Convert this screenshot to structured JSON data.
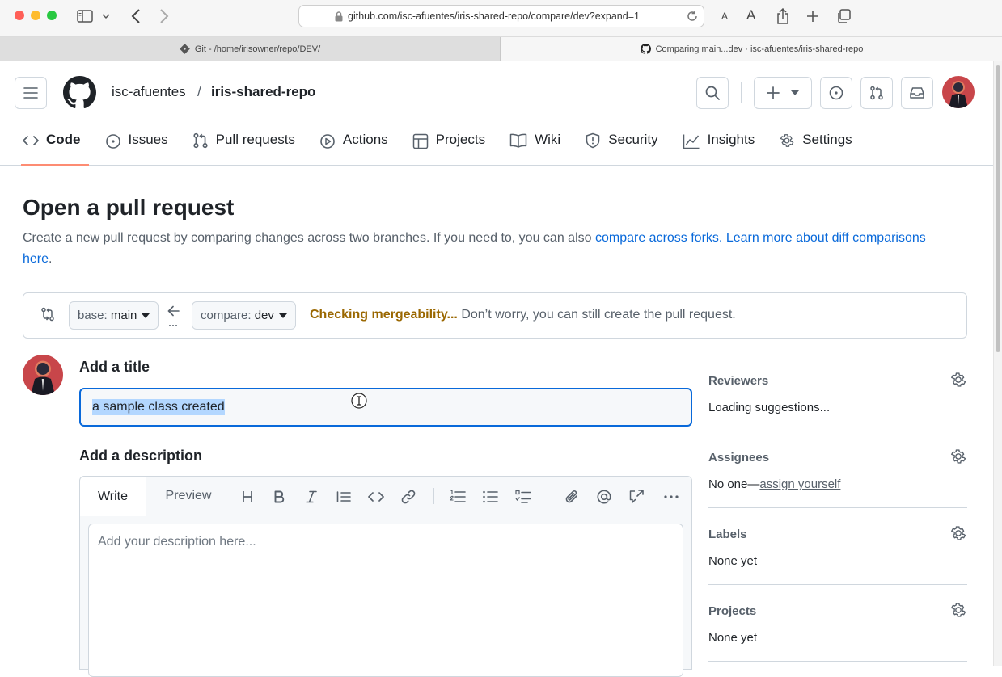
{
  "browser": {
    "url": "github.com/isc-afuentes/iris-shared-repo/compare/dev?expand=1",
    "reader_small": "A",
    "reader_large": "A",
    "tabs": [
      {
        "label": "Git - /home/irisowner/repo/DEV/",
        "active": false
      },
      {
        "label": "Comparing main...dev · isc-afuentes/iris-shared-repo",
        "active": true
      }
    ]
  },
  "header": {
    "owner": "isc-afuentes",
    "separator": "/",
    "repo": "iris-shared-repo"
  },
  "nav": [
    {
      "label": "Code",
      "icon": "code-icon",
      "active": true
    },
    {
      "label": "Issues",
      "icon": "issue-icon",
      "active": false
    },
    {
      "label": "Pull requests",
      "icon": "pull-request-icon",
      "active": false
    },
    {
      "label": "Actions",
      "icon": "play-icon",
      "active": false
    },
    {
      "label": "Projects",
      "icon": "table-icon",
      "active": false
    },
    {
      "label": "Wiki",
      "icon": "book-icon",
      "active": false
    },
    {
      "label": "Security",
      "icon": "shield-icon",
      "active": false
    },
    {
      "label": "Insights",
      "icon": "graph-icon",
      "active": false
    },
    {
      "label": "Settings",
      "icon": "gear-icon",
      "active": false
    }
  ],
  "main": {
    "title": "Open a pull request",
    "description_prefix": "Create a new pull request by comparing changes across two branches. If you need to, you can also ",
    "link_forks": "compare across forks.",
    "link_learn": "Learn more about diff comparisons here",
    "description_suffix": ".",
    "compare": {
      "base_label": "base:",
      "base_value": "main",
      "compare_label": "compare:",
      "compare_value": "dev",
      "status_bold": "Checking mergeability...",
      "status_text": " Don’t worry, you can still create the pull request."
    },
    "title_label": "Add a title",
    "title_value": "a sample class created",
    "description_label": "Add a description",
    "editor": {
      "write_tab": "Write",
      "preview_tab": "Preview",
      "placeholder": "Add your description here..."
    }
  },
  "sidebar": {
    "reviewers": {
      "heading": "Reviewers",
      "value": "Loading suggestions..."
    },
    "assignees": {
      "heading": "Assignees",
      "value_prefix": "No one—",
      "link": "assign yourself"
    },
    "labels": {
      "heading": "Labels",
      "value": "None yet"
    },
    "projects": {
      "heading": "Projects",
      "value": "None yet"
    }
  },
  "colors": {
    "link": "#0969da",
    "warning": "#9a6700",
    "focus_border": "#0969da",
    "active_tab_underline": "#fd8c73"
  }
}
